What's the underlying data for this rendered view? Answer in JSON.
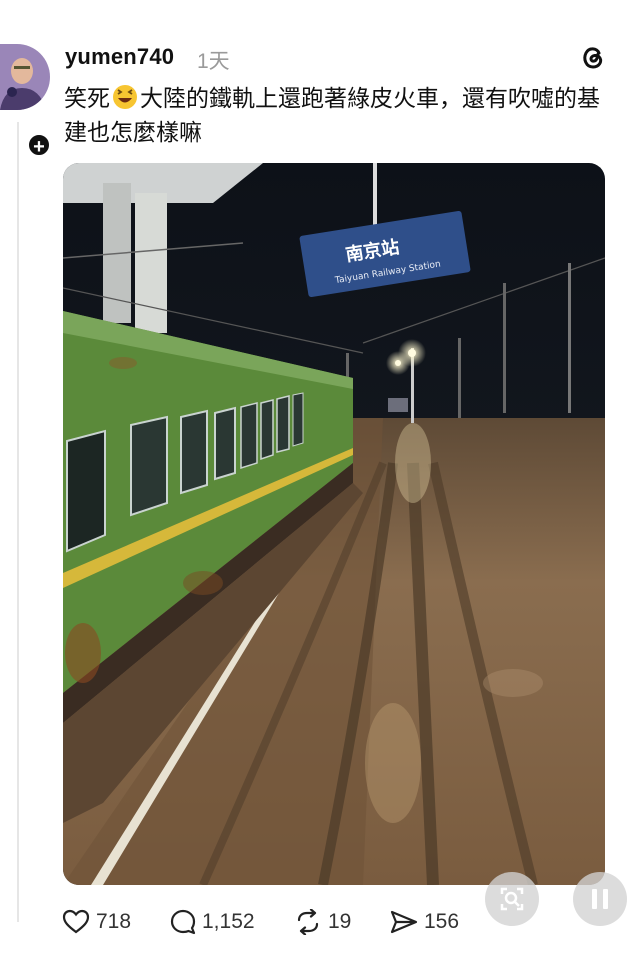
{
  "post": {
    "username": "yumen740",
    "timestamp": "1天",
    "text_before_emoji": "笑死",
    "text_after_emoji": "大陸的鐵軌上還跑著綠皮火車，還有吹噓的基建也怎麼樣嘛",
    "emoji": "laughing-emoji"
  },
  "photo": {
    "sign_title": "南京站",
    "sign_subtitle": "Taiyuan Railway Station"
  },
  "actions": {
    "likes": "718",
    "comments": "1,152",
    "reposts": "19",
    "shares": "156"
  },
  "icons": {
    "threads": "threads-logo-icon",
    "like": "heart-icon",
    "comment": "comment-icon",
    "repost": "repost-icon",
    "share": "send-icon",
    "lens": "image-search-icon",
    "pause": "pause-icon"
  },
  "colors": {
    "text": "#111111",
    "muted": "#9a9a9a",
    "train_green": "#5b8a3a",
    "train_stripe": "#d6b83a",
    "mud": "#8b6a47",
    "sign_blue": "#2f4f8a"
  }
}
